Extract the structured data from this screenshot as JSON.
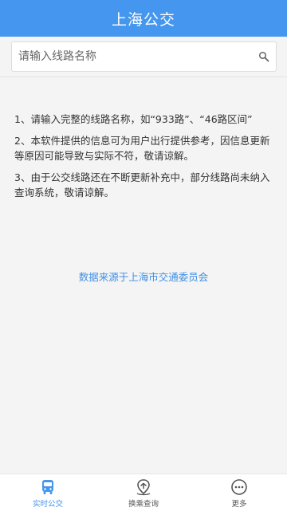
{
  "header": {
    "title": "上海公交"
  },
  "search": {
    "placeholder": "请输入线路名称",
    "value": ""
  },
  "notes": [
    "1、请输入完整的线路名称，如“933路”、“46路区间”",
    "2、本软件提供的信息可为用户出行提供参考，因信息更新等原因可能导致与实际不符，敬请谅解。",
    "3、由于公交线路还在不断更新补充中，部分线路尚未纳入查询系统，敬请谅解。"
  ],
  "source_text": "数据来源于上海市交通委员会",
  "tabbar": {
    "tabs": [
      {
        "label": "实时公交",
        "icon": "bus-icon",
        "active": true
      },
      {
        "label": "换乘查询",
        "icon": "route-icon",
        "active": false
      },
      {
        "label": "更多",
        "icon": "more-icon",
        "active": false
      }
    ]
  },
  "colors": {
    "accent": "#4596ee",
    "link": "#3f8fe6",
    "background": "#f4f4f4"
  }
}
